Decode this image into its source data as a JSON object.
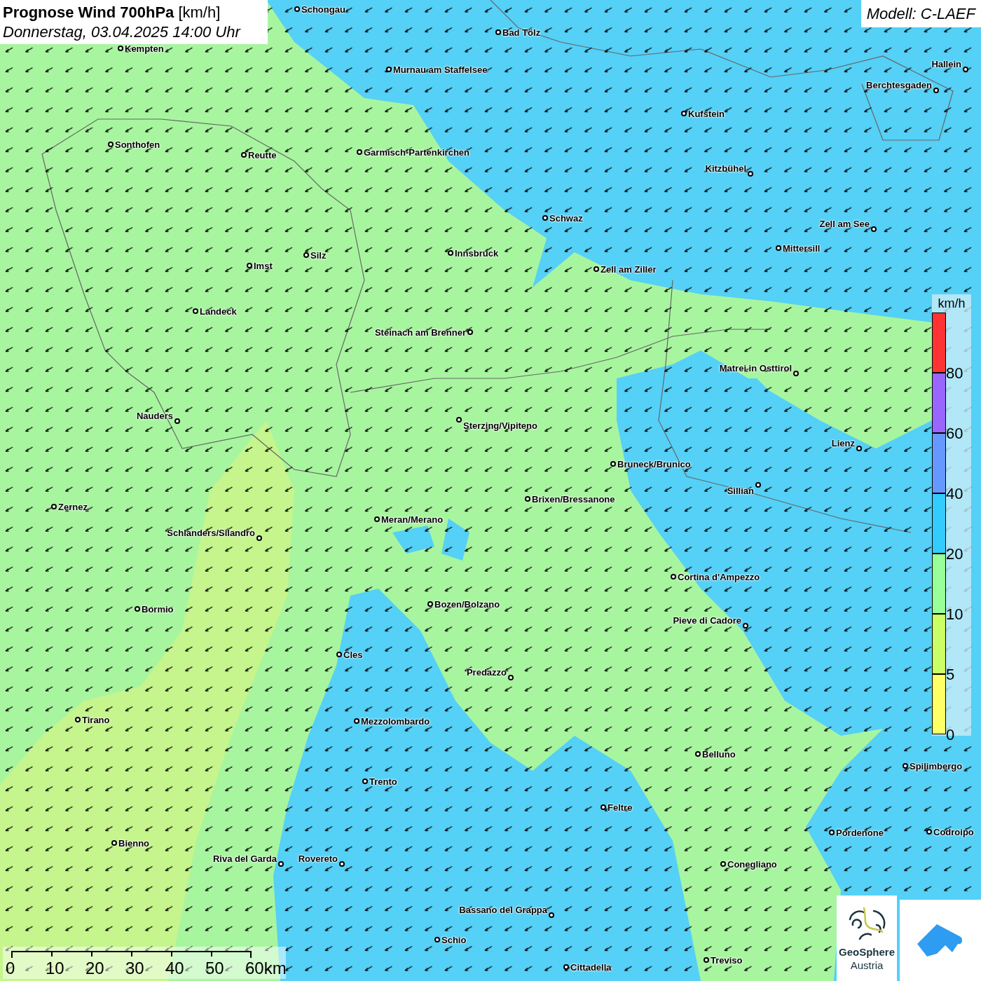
{
  "title": {
    "heading": "**Prognose Wind 700hPa** [km/h]",
    "date": "Donnerstag, 03.04.2025 14:00 Uhr"
  },
  "model": "Modell: C-LAEF",
  "cities": [
    "Schongau",
    "Bad Tölz",
    "Kempten",
    "Murnau am Staffelsee",
    "Hallein",
    "Berchtesgaden",
    "Kufstein",
    "Sonthofen",
    "Reutte",
    "Garmisch-Partenkirchen",
    "Kitzbühel",
    "Schwaz",
    "Zell am See",
    "Innsbruck",
    "Silz",
    "Mittersill",
    "Imst",
    "Zell am Ziller",
    "Landeck",
    "Steinach am Brenner",
    "Matrei in Osttirol",
    "Nauders",
    "Sterzing/Vipiteno",
    "Lienz",
    "Bruneck/Brunico",
    "Sillian",
    "Brixen/Bressanone",
    "Zernez",
    "Meran/Merano",
    "Schlanders/Silandro",
    "Cortina d'Ampezzo",
    "Bozen/Bolzano",
    "Bormio",
    "Pieve di Cadore",
    "Cles",
    "Predazzo",
    "Tirano",
    "Mezzolombardo",
    "Belluno",
    "Spilimbergo",
    "Trento",
    "Feltre",
    "Pordenone",
    "Codroipo",
    "Bienno",
    "Riva del Garda",
    "Rovereto",
    "Conegliano",
    "Bassano del Grappa",
    "Schio",
    "Treviso",
    "Cittadella"
  ],
  "legend": {
    "unit": "km/h",
    "bands": [
      {
        "color": "#ff3333",
        "label": "80"
      },
      {
        "color": "#9966ff",
        "label": "60"
      },
      {
        "color": "#6699ff",
        "label": "40"
      },
      {
        "color": "#33ccff",
        "label": "20"
      },
      {
        "color": "#99ff99",
        "label": "10"
      },
      {
        "color": "#ccff66",
        "label": "5"
      },
      {
        "color": "#ffff66",
        "label": "0"
      }
    ]
  },
  "scale": [
    "0",
    "10",
    "20",
    "30",
    "40",
    "50",
    "60km"
  ],
  "logo": {
    "name": "GeoSphere",
    "sub": "Austria"
  }
}
